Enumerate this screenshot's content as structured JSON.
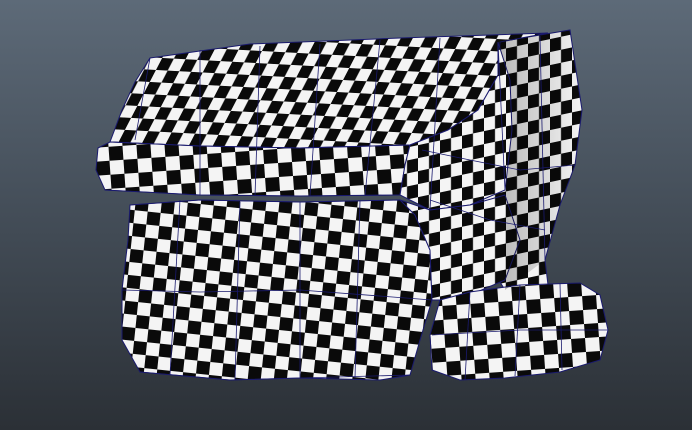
{
  "viewport": {
    "background_top": "#5d6a78",
    "background_bottom": "#2b3036",
    "wireframe_color": "#1a1a6e"
  },
  "model": {
    "texture": "checker",
    "checker_dark": "#0a0a0a",
    "checker_light": "#f4f4f4"
  }
}
